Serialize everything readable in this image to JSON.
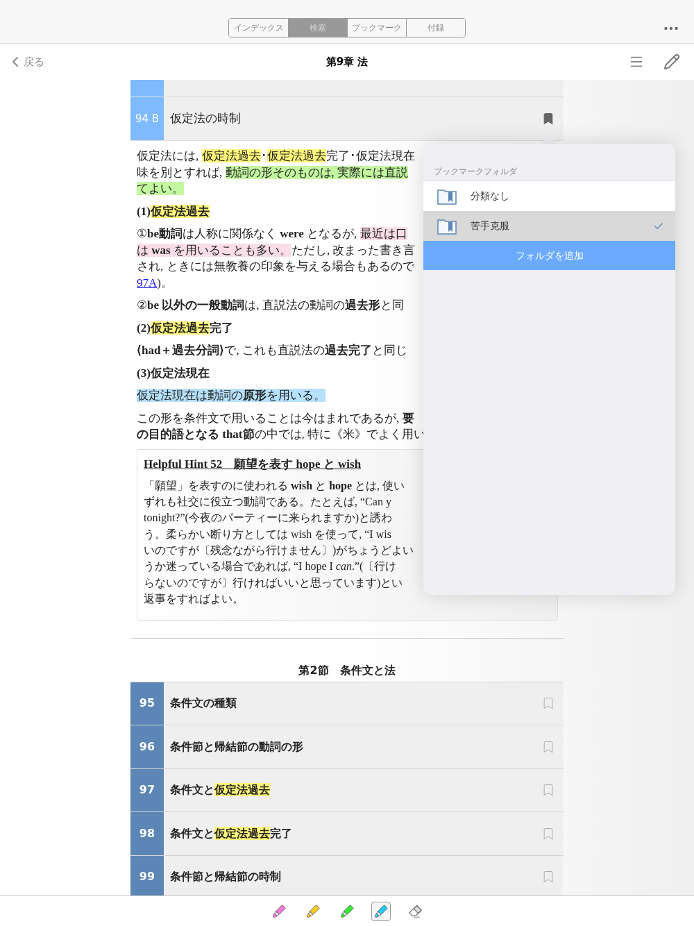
{
  "toolbar": {
    "tabs": [
      {
        "label": "インデックス",
        "selected": false
      },
      {
        "label": "検索",
        "selected": true
      },
      {
        "label": "ブックマーク",
        "selected": false
      },
      {
        "label": "付録",
        "selected": false
      }
    ]
  },
  "nav": {
    "back": "戻る",
    "title": "第9章 法"
  },
  "current_entry": {
    "number": "94 B",
    "title": "仮定法の時制",
    "bookmarked": true
  },
  "body": [
    {
      "kind": "paragraph",
      "lines": [
        [
          {
            "text": "仮定法には, "
          },
          {
            "text": "仮定法過去",
            "color": "#fff77a"
          },
          {
            "text": "･"
          },
          {
            "text": "仮定法過去",
            "color": "#fff77a"
          },
          {
            "text": "完了･仮定法現在"
          }
        ],
        [
          {
            "text": "味を別とすれば, "
          },
          {
            "text": "動詞の形そのものは, 実際には直説",
            "color": "#c3f7a0"
          }
        ],
        [
          {
            "text": "てよい。",
            "color": "#c3f7a0"
          }
        ]
      ]
    },
    {
      "kind": "heading",
      "lines": [
        [
          {
            "text": "(1)"
          },
          {
            "text": "仮定法過去",
            "color": "#fff77a"
          }
        ]
      ]
    },
    {
      "kind": "paragraph",
      "lines": [
        [
          {
            "text": "①**be動詞**は人称に関係なく **were** となるが, "
          },
          {
            "text": "最近は口",
            "color": "#fbdde6"
          }
        ],
        [
          {
            "text": "は **was** を用いることも多い。",
            "color": "#fbdde6"
          },
          {
            "text": "ただし, 改まった書き言"
          }
        ],
        [
          {
            "text": "され, ときには無教養の印象を与える場合もあるので"
          }
        ],
        [
          {
            "text": "97A",
            "link": true
          },
          {
            "text": ")。"
          }
        ]
      ]
    },
    {
      "kind": "paragraph",
      "lines": [
        [
          {
            "text": "②**be 以外の一般動詞**は, 直説法の動詞の**過去形**と同"
          }
        ]
      ]
    },
    {
      "kind": "heading",
      "lines": [
        [
          {
            "text": "(2)"
          },
          {
            "text": "仮定法過去",
            "color": "#fff77a"
          },
          {
            "text": "完了"
          }
        ]
      ]
    },
    {
      "kind": "paragraph",
      "lines": [
        [
          {
            "text": "**⟨had＋過去分詞⟩**で, これも直説法の**過去完了**と同じ"
          }
        ]
      ]
    },
    {
      "kind": "heading",
      "lines": [
        [
          {
            "text": "(3)仮定法現在"
          }
        ]
      ]
    },
    {
      "kind": "paragraph",
      "lines": [
        [
          {
            "text": "仮定法現在は動詞の**原形**を用いる。",
            "color": "#b5e1fa"
          }
        ]
      ]
    },
    {
      "kind": "paragraph",
      "lines": [
        [
          {
            "text": "この形を条件文で用いることは今はまれであるが, **要**"
          }
        ],
        [
          {
            "text": "**の目的語となる that節**の中では, 特に《米》でよく用い"
          }
        ]
      ]
    }
  ],
  "hint": {
    "title": "Helpful Hint 52　願望を表す hope と wish",
    "lines": [
      "「願望」を表すのに使われる **wish** と **hope** とは, 使い",
      "ずれも社交に役立つ動詞である。たとえば, “Can y",
      "tonight?”(今夜のパーティーに来られますか)と誘わ",
      "う。柔らかい断り方としては wish を使って, “I wis",
      "いのですが〔残念ながら行けません〕)がちょうどよい",
      "うか迷っている場合であれば, “I hope I *can*.”(〔行け",
      "らないのですが〕行ければいいと思っています)とい",
      "返事をすればよい。"
    ]
  },
  "section": {
    "title": "第2節　条件文と法",
    "entries": [
      {
        "number": "95",
        "segments": [
          {
            "text": "条件文の種類"
          }
        ],
        "bookmarked": false
      },
      {
        "number": "96",
        "segments": [
          {
            "text": "条件節と帰結節の動詞の形"
          }
        ],
        "bookmarked": false
      },
      {
        "number": "97",
        "segments": [
          {
            "text": "条件文と"
          },
          {
            "text": "仮定法過去",
            "color": "#fff77a"
          }
        ],
        "bookmarked": false
      },
      {
        "number": "98",
        "segments": [
          {
            "text": "条件文と"
          },
          {
            "text": "仮定法過去",
            "color": "#fff77a"
          },
          {
            "text": "完了"
          }
        ],
        "bookmarked": false
      },
      {
        "number": "99",
        "segments": [
          {
            "text": "条件節と帰結節の時制"
          }
        ],
        "bookmarked": false
      }
    ]
  },
  "popover": {
    "header": "ブックマークフォルダ",
    "folders": [
      {
        "name": "分類なし",
        "selected": false
      },
      {
        "name": "苦手克服",
        "selected": true
      }
    ],
    "add_button": "フォルダを追加"
  },
  "tools": [
    {
      "kind": "marker",
      "color": "#ff77dd",
      "selected": false
    },
    {
      "kind": "marker",
      "color": "#ffcc22",
      "selected": false
    },
    {
      "kind": "marker",
      "color": "#33ee33",
      "selected": false
    },
    {
      "kind": "marker",
      "color": "#22ccff",
      "selected": true
    },
    {
      "kind": "eraser",
      "selected": false
    }
  ]
}
